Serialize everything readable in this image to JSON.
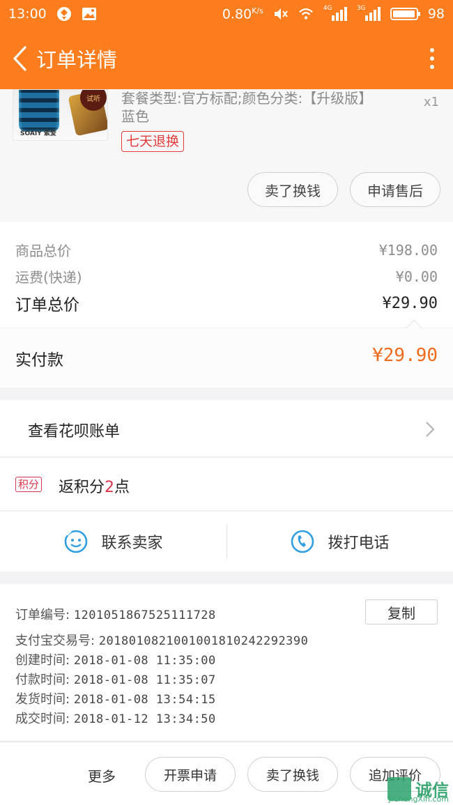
{
  "status_bar": {
    "time": "13:00",
    "net_speed": "0.80",
    "net_unit": "K/s",
    "network_4g": "4G",
    "network_3g": "3G",
    "battery": "98"
  },
  "app_bar": {
    "title": "订单详情"
  },
  "product": {
    "thumb_brand": "SOAIY 索爱",
    "thumb_badge": "试听",
    "sku": "套餐类型:官方标配;颜色分类:【升级版】蓝色",
    "quantity": "x1",
    "return_tag": "七天退换",
    "actions": [
      "卖了换钱",
      "申请售后"
    ]
  },
  "prices": {
    "goods_total_label": "商品总价",
    "goods_total_value": "¥198.00",
    "shipping_label": "运费(快递)",
    "shipping_value": "¥0.00",
    "order_total_label": "订单总价",
    "order_total_value": "¥29.90",
    "paid_label": "实付款",
    "paid_value": "¥29.90"
  },
  "huabei": {
    "label": "查看花呗账单"
  },
  "points": {
    "tag": "积分",
    "prefix": "返积分",
    "num": "2",
    "suffix": "点"
  },
  "contact": {
    "seller": "联系卖家",
    "phone": "拨打电话"
  },
  "order_info": {
    "copy_label": "复制",
    "lines": [
      {
        "label": "订单编号:",
        "value": "1201051867525111728"
      },
      {
        "label": "支付宝交易号:",
        "value": "2018010821001001810242292390"
      },
      {
        "label": "创建时间:",
        "value": "2018-01-08 11:35:00"
      },
      {
        "label": "付款时间:",
        "value": "2018-01-08 11:35:07"
      },
      {
        "label": "发货时间:",
        "value": "2018-01-08 13:54:15"
      },
      {
        "label": "成交时间:",
        "value": "2018-01-12 13:34:50"
      }
    ]
  },
  "bottom_bar": {
    "more": "更多",
    "buttons": [
      "开票申请",
      "卖了换钱",
      "追加评价"
    ]
  },
  "watermark": {
    "text": "诚信",
    "domain": "JiChengXin.com"
  },
  "colors": {
    "brand_orange": "#fb7d1e",
    "paid_orange": "#f06a1d",
    "alert_red": "#e33a3a",
    "points_red": "#d9344b",
    "icon_blue": "#2f9fe0"
  }
}
